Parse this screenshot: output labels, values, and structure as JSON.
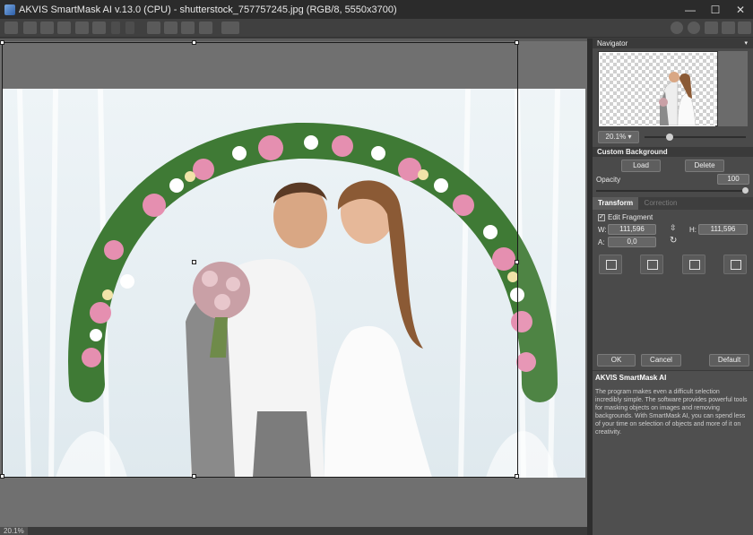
{
  "window": {
    "title": "AKVIS SmartMask AI v.13.0 (CPU) - shutterstock_757757245.jpg (RGB/8, 5550x3700)",
    "controls": [
      "—",
      "☐",
      "✕"
    ]
  },
  "toolbar": {
    "icons": [
      "open-icon",
      "save-icon",
      "save-as-icon",
      "print-icon",
      "batch-icon",
      "export-icon",
      "undo-icon",
      "redo-icon",
      "layer-icon",
      "compare-icon",
      "mask-icon",
      "image-icon",
      "before-after-icon",
      "info-icon",
      "help-icon",
      "settings-icon",
      "plugin-icon",
      "feedback-icon"
    ]
  },
  "status": {
    "zoom": "20.1%"
  },
  "navigator": {
    "header": "Navigator",
    "zoom_value": "20.1% ▾",
    "zoom_fraction": 0.2
  },
  "custom_background": {
    "header": "Custom Background",
    "load_label": "Load",
    "delete_label": "Delete",
    "opacity_label": "Opacity",
    "opacity_value": "100"
  },
  "tabs": [
    {
      "label": "Transform",
      "active": true
    },
    {
      "label": "Correction",
      "active": false
    }
  ],
  "transform": {
    "edit_fragment_label": "Edit Fragment",
    "edit_fragment_checked": "✓",
    "w_label": "W:",
    "w_value": "111,596",
    "h_label": "H:",
    "h_value": "111,596",
    "a_label": "A:",
    "a_value": "0,0"
  },
  "actions": {
    "ok_label": "OK",
    "cancel_label": "Cancel",
    "default_label": "Default"
  },
  "info": {
    "title": "AKVIS SmartMask AI",
    "text": "The program makes even a difficult selection incredibly simple. The software provides powerful tools for masking objects on images and removing backgrounds. With SmartMask AI, you can spend less of your time on selection of objects and more of it on creativity."
  }
}
